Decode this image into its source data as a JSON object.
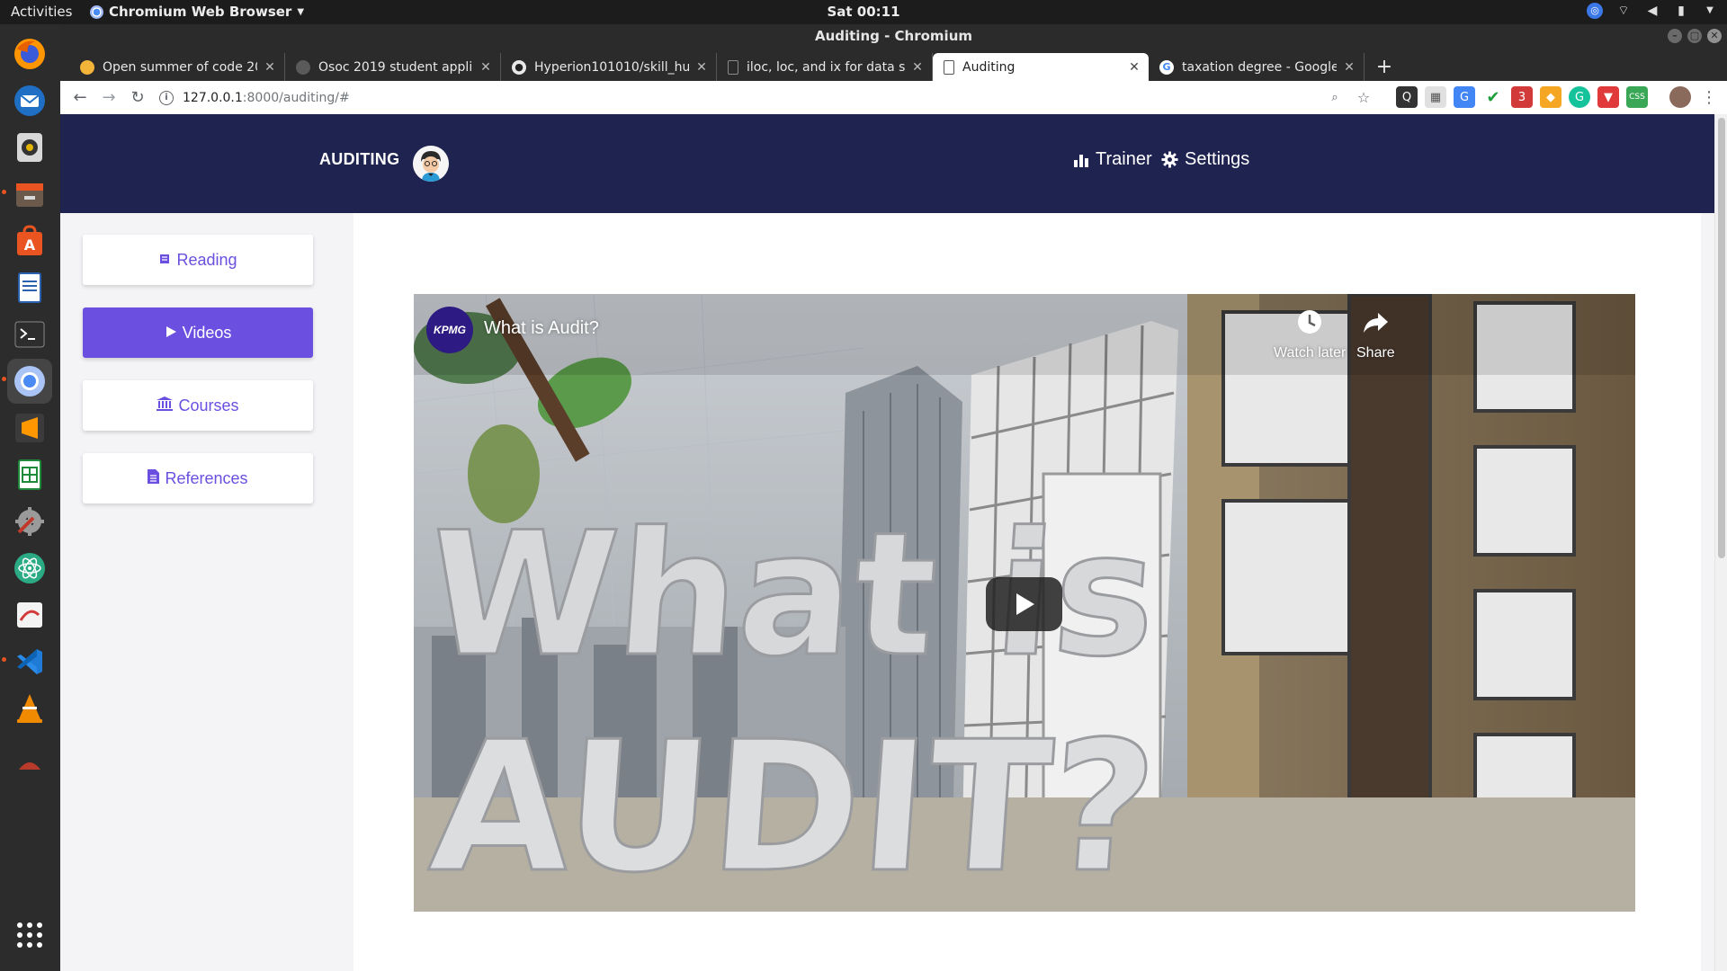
{
  "os": {
    "activities": "Activities",
    "app_menu": "Chromium Web Browser",
    "clock": "Sat 00:11",
    "dock": [
      {
        "name": "firefox-icon",
        "color": "#e66000"
      },
      {
        "name": "thunderbird-icon",
        "color": "#1f6fc5"
      },
      {
        "name": "rhythmbox-icon",
        "color": "#8a8a8a"
      },
      {
        "name": "files-icon",
        "color": "#6b5a4b"
      },
      {
        "name": "software-center-icon",
        "color": "#e95420"
      },
      {
        "name": "writer-icon",
        "color": "#2a62b0"
      },
      {
        "name": "terminal-icon",
        "color": "#333333"
      },
      {
        "name": "chromium-icon",
        "color": "#4a8af4"
      },
      {
        "name": "sublime-text-icon",
        "color": "#3b3b3b"
      },
      {
        "name": "calc-icon",
        "color": "#1e8a3a"
      },
      {
        "name": "settings-icon",
        "color": "#c0392b"
      },
      {
        "name": "atom-icon",
        "color": "#2bab83"
      },
      {
        "name": "evince-icon",
        "color": "#d23a3a"
      },
      {
        "name": "vscode-icon",
        "color": "#1f7bd6"
      },
      {
        "name": "vlc-icon",
        "color": "#f08a00"
      },
      {
        "name": "show-apps-icon",
        "color": "#2c2c2c"
      }
    ]
  },
  "browser": {
    "window_title": "Auditing - Chromium",
    "tabs": [
      {
        "title": "Open summer of code 20",
        "fav_color": "#f2b53a"
      },
      {
        "title": "Osoc 2019 student applic",
        "fav_color": "#5a5a5a"
      },
      {
        "title": "Hyperion101010/skill_hut",
        "fav_color": "#e8e8e8"
      },
      {
        "title": "iloc, loc, and ix for data se",
        "fav_color": "#8a8a8a"
      },
      {
        "title": "Auditing",
        "fav_color": "#ffffff"
      },
      {
        "title": "taxation degree - Google",
        "fav_color": "#ffffff"
      }
    ],
    "url_host": "127.0.0.1",
    "url_path": ":8000/auditing/#"
  },
  "site": {
    "brand": "AUDITING",
    "nav": {
      "trainer": "Trainer",
      "settings": "Settings"
    },
    "sidebar": [
      {
        "label": "Reading",
        "icon": "book-icon",
        "active": false
      },
      {
        "label": "Videos",
        "icon": "play-icon",
        "active": true
      },
      {
        "label": "Courses",
        "icon": "bank-icon",
        "active": false
      },
      {
        "label": "References",
        "icon": "document-icon",
        "active": false
      }
    ],
    "accent": "#6a4fe0",
    "header_bg": "#1f2350"
  },
  "video": {
    "title": "What is Audit?",
    "channel_logo": "KPMG",
    "watch_later": "Watch later",
    "share": "Share",
    "thumbnail_text_line1": "What is",
    "thumbnail_text_line2": "AUDIT?"
  }
}
